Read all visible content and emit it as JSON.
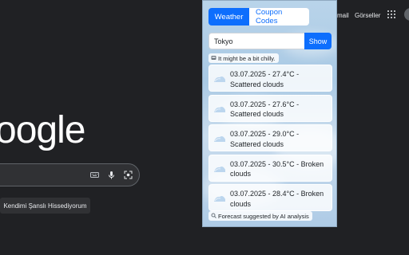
{
  "google": {
    "top_links": [
      "mail",
      "Görseller"
    ],
    "logo_text": "oogle",
    "lucky_button": "Kendimi Şanslı Hissediyorum"
  },
  "popup": {
    "tabs": [
      {
        "label": "Weather",
        "active": true
      },
      {
        "label": "Coupon Codes",
        "active": false
      }
    ],
    "city_input_value": "Tokyo",
    "show_button": "Show",
    "hint": "It might be a bit chilly.",
    "forecasts": [
      {
        "text": "03.07.2025 - 27.4°C - Scattered clouds",
        "icon": "cloud-icon"
      },
      {
        "text": "03.07.2025 - 27.6°C - Scattered clouds",
        "icon": "cloud-icon"
      },
      {
        "text": "03.07.2025 - 29.0°C - Scattered clouds",
        "icon": "cloud-icon"
      },
      {
        "text": "03.07.2025 - 30.5°C - Broken clouds",
        "icon": "cloud-icon"
      },
      {
        "text": "03.07.2025 - 28.4°C - Broken clouds",
        "icon": "cloud-icon"
      }
    ],
    "footer": "Forecast suggested by AI analysis"
  },
  "colors": {
    "accent": "#0d6efd",
    "page_bg": "#202124"
  }
}
